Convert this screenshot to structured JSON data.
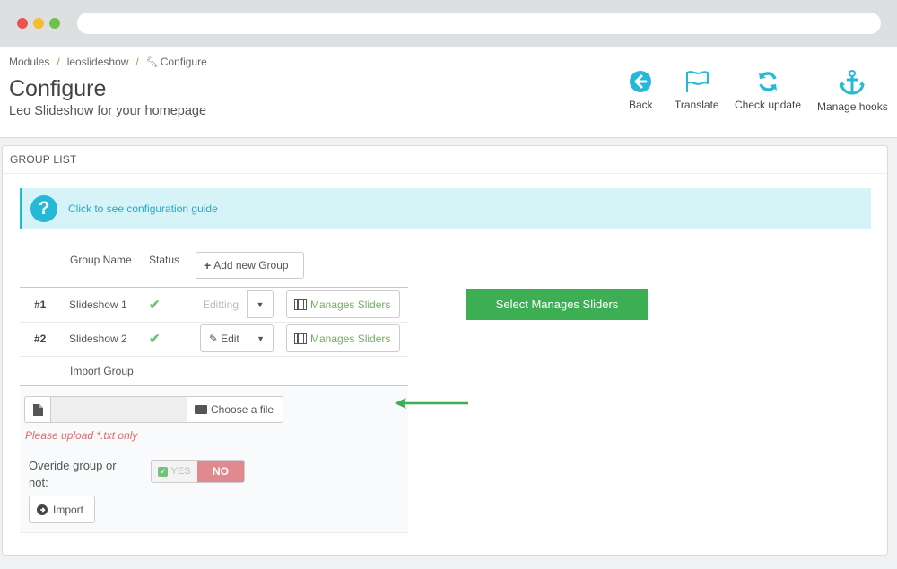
{
  "breadcrumb": {
    "items": [
      "Modules",
      "leoslideshow",
      "Configure"
    ]
  },
  "header": {
    "title": "Configure",
    "subtitle": "Leo Slideshow for your homepage"
  },
  "toolbar": [
    {
      "label": "Back",
      "icon": "arrow-left-circle-icon"
    },
    {
      "label": "Translate",
      "icon": "flag-icon"
    },
    {
      "label": "Check update",
      "icon": "refresh-icon"
    },
    {
      "label": "Manage hooks",
      "icon": "anchor-icon"
    }
  ],
  "panel": {
    "heading": "GROUP LIST",
    "guide_link": "Click to see configuration guide",
    "columns": {
      "group_name": "Group Name",
      "status": "Status"
    },
    "add_button": "Add new Group",
    "rows": [
      {
        "id": "#1",
        "name": "Slideshow 1",
        "action": "Editting",
        "manage": "Manages Sliders"
      },
      {
        "id": "#2",
        "name": "Slideshow 2",
        "action": "Edit",
        "manage": "Manages Sliders"
      }
    ],
    "import_label": "Import Group",
    "choose_file": "Choose a file",
    "upload_hint": "Please upload *.txt only",
    "override_label": "Overide group or not:",
    "toggle_yes": "YES",
    "toggle_no": "NO",
    "import_button": "Import"
  },
  "callout": {
    "text": "Select Manages Sliders"
  },
  "colors": {
    "accent_blue": "#25b9d7",
    "green": "#6cb35a",
    "callout": "#3eae55",
    "danger": "#e08a8f"
  }
}
